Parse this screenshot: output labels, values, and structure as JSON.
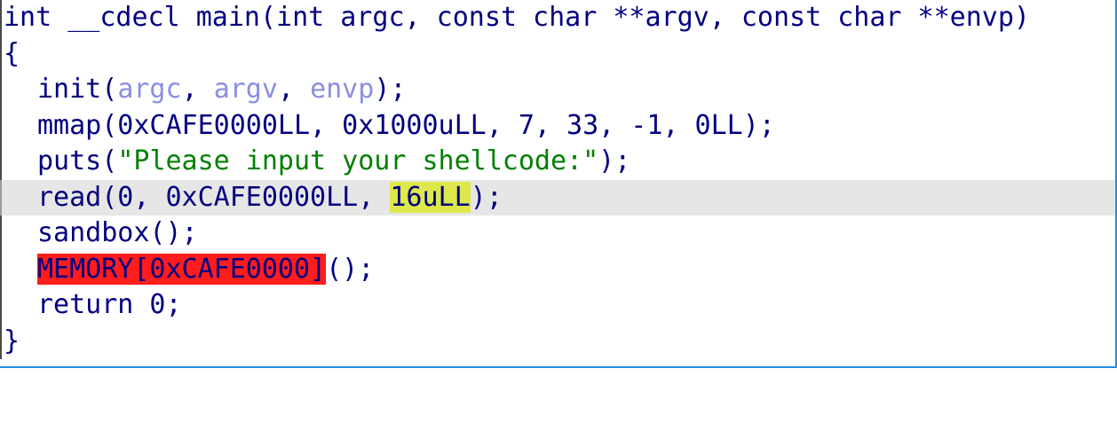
{
  "code": {
    "signature": "int __cdecl main(int argc, const char **argv, const char **envp)",
    "open_brace": "{",
    "close_brace": "}",
    "init": {
      "fn": "init(",
      "arg1": "argc",
      "sep1": ", ",
      "arg2": "argv",
      "sep2": ", ",
      "arg3": "envp",
      "end": ");"
    },
    "mmap": "mmap(0xCAFE0000LL, 0x1000uLL, 7, 33, -1, 0LL);",
    "puts": {
      "fn": "puts(",
      "str": "\"Please input your shellcode:\"",
      "end": ");"
    },
    "read": {
      "prefix": "read(0, 0xCAFE0000LL, ",
      "highlight": "16uLL",
      "end": ");"
    },
    "sandbox": "sandbox();",
    "memory_call": {
      "highlight": "MEMORY[0xCAFE0000]",
      "end": "();"
    },
    "return": "return 0;"
  },
  "colors": {
    "keyword": "#000080",
    "variable": "#8a8ee0",
    "string": "#008000",
    "current_line": "#e6e6e6",
    "search_highlight": "#dfe84a",
    "error_highlight": "#ff1c1c",
    "border_accent": "#1f8fe0"
  }
}
